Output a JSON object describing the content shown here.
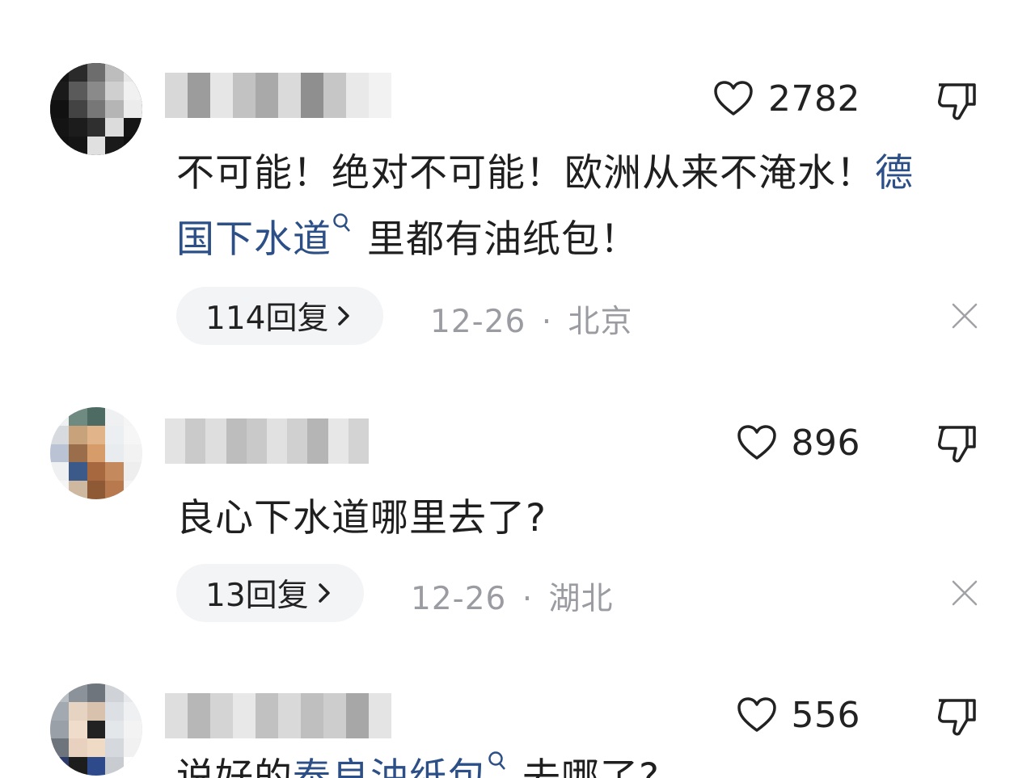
{
  "comments": [
    {
      "like_count": "2782",
      "text_before": "不可能！绝对不可能！欧洲从来不淹水！",
      "link": "德国下水道",
      "text_after": "里都有油纸包！",
      "reply_label": "114回复",
      "date": "12-26",
      "location": "北京"
    },
    {
      "like_count": "896",
      "text": "良心下水道哪里去了?",
      "reply_label": "13回复",
      "date": "12-26",
      "location": "湖北"
    },
    {
      "like_count": "556",
      "text_before": "说好的",
      "link": "泰良油纸包",
      "text_after": "去哪了?"
    }
  ],
  "separator": "·",
  "icons": {
    "like": "heart-outline-icon",
    "dislike": "thumbs-down-icon",
    "close": "close-icon",
    "chevron": "chevron-right-icon",
    "search": "search-icon"
  },
  "colors": {
    "link": "#2b4f86",
    "meta": "#9a9ca1",
    "pill": "#f3f4f6"
  }
}
